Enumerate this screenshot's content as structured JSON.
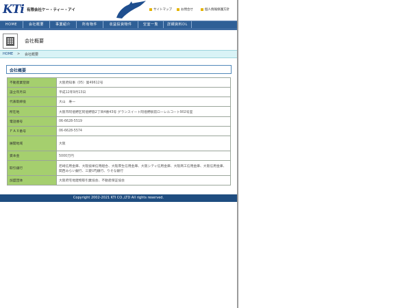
{
  "header": {
    "logo": "KTi",
    "company": "有限会社ケー・ティー・アイ",
    "links": [
      "サイトマップ",
      "お問合せ",
      "個人情報保護方針"
    ]
  },
  "nav": [
    "HOME",
    "会社概要",
    "事業紹介",
    "所有物件",
    "収益投資物件",
    "空室一覧",
    "詳細資料DL"
  ],
  "page_title": "会社概要",
  "breadcrumb": {
    "home": "HOME",
    "sep": ">",
    "current": "会社概要"
  },
  "section_title": "会社概要",
  "rows": [
    {
      "label": "不動産業登録",
      "value": "大阪府知事（05）第49612号"
    },
    {
      "label": "設立年月日",
      "value": "平成12年9月13日"
    },
    {
      "label": "代表取締役",
      "value": "大山　寿一"
    },
    {
      "label": "所在地",
      "value": "大阪市阿倍野区阿倍野筋2丁目4番43号 グランスイート阿倍野駅前ローレルコート902号室"
    },
    {
      "label": "電話番号",
      "value": "06-6628-5519"
    },
    {
      "label": "ＦＡＸ番号",
      "value": "06-6628-5574"
    },
    {
      "label": "展開地域",
      "value": "大阪"
    },
    {
      "label": "資本金",
      "value": "5000万円"
    },
    {
      "label": "取引銀行",
      "value": "尼崎信用金庫、大阪協栄信用組合、大阪厚生信用金庫、大阪シティ信用金庫、大阪商工信用金庫、大阪信用金庫、関西みらい銀行、三菱UFJ銀行、りそな銀行"
    },
    {
      "label": "加盟団体",
      "value": "大阪府宅地建物取引業協会、不動産保証協会"
    }
  ],
  "footer": "Copyright 2002-2021 KTI CO.,LTD All rights reserved."
}
